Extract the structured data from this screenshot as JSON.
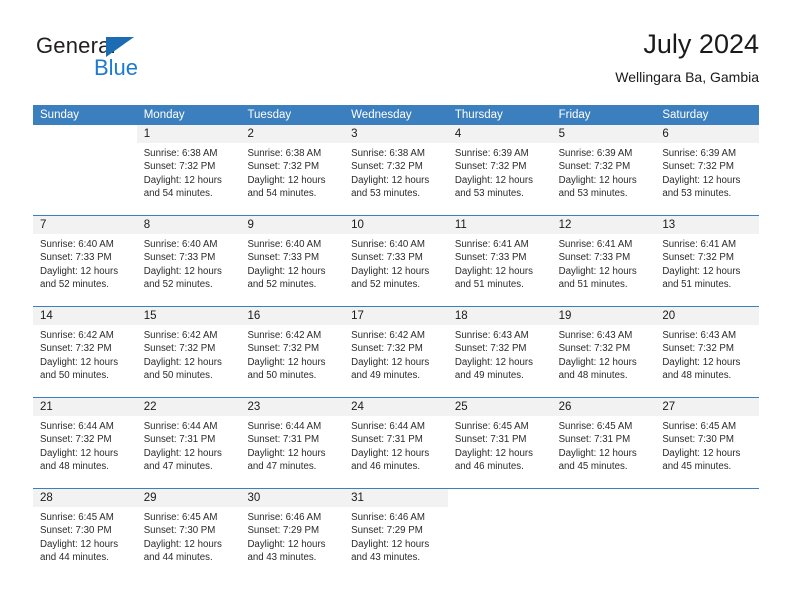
{
  "brand": {
    "name_part1": "General",
    "name_part2": "Blue"
  },
  "header": {
    "title": "July 2024",
    "subtitle": "Wellingara Ba, Gambia",
    "accent_color": "#3c7fbf",
    "day_band_color": "#f2f2f2"
  },
  "weekdays": [
    "Sunday",
    "Monday",
    "Tuesday",
    "Wednesday",
    "Thursday",
    "Friday",
    "Saturday"
  ],
  "weeks": [
    [
      {
        "num": "",
        "empty": true
      },
      {
        "num": "1",
        "sunrise": "Sunrise: 6:38 AM",
        "sunset": "Sunset: 7:32 PM",
        "daylight1": "Daylight: 12 hours",
        "daylight2": "and 54 minutes."
      },
      {
        "num": "2",
        "sunrise": "Sunrise: 6:38 AM",
        "sunset": "Sunset: 7:32 PM",
        "daylight1": "Daylight: 12 hours",
        "daylight2": "and 54 minutes."
      },
      {
        "num": "3",
        "sunrise": "Sunrise: 6:38 AM",
        "sunset": "Sunset: 7:32 PM",
        "daylight1": "Daylight: 12 hours",
        "daylight2": "and 53 minutes."
      },
      {
        "num": "4",
        "sunrise": "Sunrise: 6:39 AM",
        "sunset": "Sunset: 7:32 PM",
        "daylight1": "Daylight: 12 hours",
        "daylight2": "and 53 minutes."
      },
      {
        "num": "5",
        "sunrise": "Sunrise: 6:39 AM",
        "sunset": "Sunset: 7:32 PM",
        "daylight1": "Daylight: 12 hours",
        "daylight2": "and 53 minutes."
      },
      {
        "num": "6",
        "sunrise": "Sunrise: 6:39 AM",
        "sunset": "Sunset: 7:32 PM",
        "daylight1": "Daylight: 12 hours",
        "daylight2": "and 53 minutes."
      }
    ],
    [
      {
        "num": "7",
        "sunrise": "Sunrise: 6:40 AM",
        "sunset": "Sunset: 7:33 PM",
        "daylight1": "Daylight: 12 hours",
        "daylight2": "and 52 minutes."
      },
      {
        "num": "8",
        "sunrise": "Sunrise: 6:40 AM",
        "sunset": "Sunset: 7:33 PM",
        "daylight1": "Daylight: 12 hours",
        "daylight2": "and 52 minutes."
      },
      {
        "num": "9",
        "sunrise": "Sunrise: 6:40 AM",
        "sunset": "Sunset: 7:33 PM",
        "daylight1": "Daylight: 12 hours",
        "daylight2": "and 52 minutes."
      },
      {
        "num": "10",
        "sunrise": "Sunrise: 6:40 AM",
        "sunset": "Sunset: 7:33 PM",
        "daylight1": "Daylight: 12 hours",
        "daylight2": "and 52 minutes."
      },
      {
        "num": "11",
        "sunrise": "Sunrise: 6:41 AM",
        "sunset": "Sunset: 7:33 PM",
        "daylight1": "Daylight: 12 hours",
        "daylight2": "and 51 minutes."
      },
      {
        "num": "12",
        "sunrise": "Sunrise: 6:41 AM",
        "sunset": "Sunset: 7:33 PM",
        "daylight1": "Daylight: 12 hours",
        "daylight2": "and 51 minutes."
      },
      {
        "num": "13",
        "sunrise": "Sunrise: 6:41 AM",
        "sunset": "Sunset: 7:32 PM",
        "daylight1": "Daylight: 12 hours",
        "daylight2": "and 51 minutes."
      }
    ],
    [
      {
        "num": "14",
        "sunrise": "Sunrise: 6:42 AM",
        "sunset": "Sunset: 7:32 PM",
        "daylight1": "Daylight: 12 hours",
        "daylight2": "and 50 minutes."
      },
      {
        "num": "15",
        "sunrise": "Sunrise: 6:42 AM",
        "sunset": "Sunset: 7:32 PM",
        "daylight1": "Daylight: 12 hours",
        "daylight2": "and 50 minutes."
      },
      {
        "num": "16",
        "sunrise": "Sunrise: 6:42 AM",
        "sunset": "Sunset: 7:32 PM",
        "daylight1": "Daylight: 12 hours",
        "daylight2": "and 50 minutes."
      },
      {
        "num": "17",
        "sunrise": "Sunrise: 6:42 AM",
        "sunset": "Sunset: 7:32 PM",
        "daylight1": "Daylight: 12 hours",
        "daylight2": "and 49 minutes."
      },
      {
        "num": "18",
        "sunrise": "Sunrise: 6:43 AM",
        "sunset": "Sunset: 7:32 PM",
        "daylight1": "Daylight: 12 hours",
        "daylight2": "and 49 minutes."
      },
      {
        "num": "19",
        "sunrise": "Sunrise: 6:43 AM",
        "sunset": "Sunset: 7:32 PM",
        "daylight1": "Daylight: 12 hours",
        "daylight2": "and 48 minutes."
      },
      {
        "num": "20",
        "sunrise": "Sunrise: 6:43 AM",
        "sunset": "Sunset: 7:32 PM",
        "daylight1": "Daylight: 12 hours",
        "daylight2": "and 48 minutes."
      }
    ],
    [
      {
        "num": "21",
        "sunrise": "Sunrise: 6:44 AM",
        "sunset": "Sunset: 7:32 PM",
        "daylight1": "Daylight: 12 hours",
        "daylight2": "and 48 minutes."
      },
      {
        "num": "22",
        "sunrise": "Sunrise: 6:44 AM",
        "sunset": "Sunset: 7:31 PM",
        "daylight1": "Daylight: 12 hours",
        "daylight2": "and 47 minutes."
      },
      {
        "num": "23",
        "sunrise": "Sunrise: 6:44 AM",
        "sunset": "Sunset: 7:31 PM",
        "daylight1": "Daylight: 12 hours",
        "daylight2": "and 47 minutes."
      },
      {
        "num": "24",
        "sunrise": "Sunrise: 6:44 AM",
        "sunset": "Sunset: 7:31 PM",
        "daylight1": "Daylight: 12 hours",
        "daylight2": "and 46 minutes."
      },
      {
        "num": "25",
        "sunrise": "Sunrise: 6:45 AM",
        "sunset": "Sunset: 7:31 PM",
        "daylight1": "Daylight: 12 hours",
        "daylight2": "and 46 minutes."
      },
      {
        "num": "26",
        "sunrise": "Sunrise: 6:45 AM",
        "sunset": "Sunset: 7:31 PM",
        "daylight1": "Daylight: 12 hours",
        "daylight2": "and 45 minutes."
      },
      {
        "num": "27",
        "sunrise": "Sunrise: 6:45 AM",
        "sunset": "Sunset: 7:30 PM",
        "daylight1": "Daylight: 12 hours",
        "daylight2": "and 45 minutes."
      }
    ],
    [
      {
        "num": "28",
        "sunrise": "Sunrise: 6:45 AM",
        "sunset": "Sunset: 7:30 PM",
        "daylight1": "Daylight: 12 hours",
        "daylight2": "and 44 minutes."
      },
      {
        "num": "29",
        "sunrise": "Sunrise: 6:45 AM",
        "sunset": "Sunset: 7:30 PM",
        "daylight1": "Daylight: 12 hours",
        "daylight2": "and 44 minutes."
      },
      {
        "num": "30",
        "sunrise": "Sunrise: 6:46 AM",
        "sunset": "Sunset: 7:29 PM",
        "daylight1": "Daylight: 12 hours",
        "daylight2": "and 43 minutes."
      },
      {
        "num": "31",
        "sunrise": "Sunrise: 6:46 AM",
        "sunset": "Sunset: 7:29 PM",
        "daylight1": "Daylight: 12 hours",
        "daylight2": "and 43 minutes."
      },
      {
        "num": "",
        "empty": true
      },
      {
        "num": "",
        "empty": true
      },
      {
        "num": "",
        "empty": true
      }
    ]
  ]
}
